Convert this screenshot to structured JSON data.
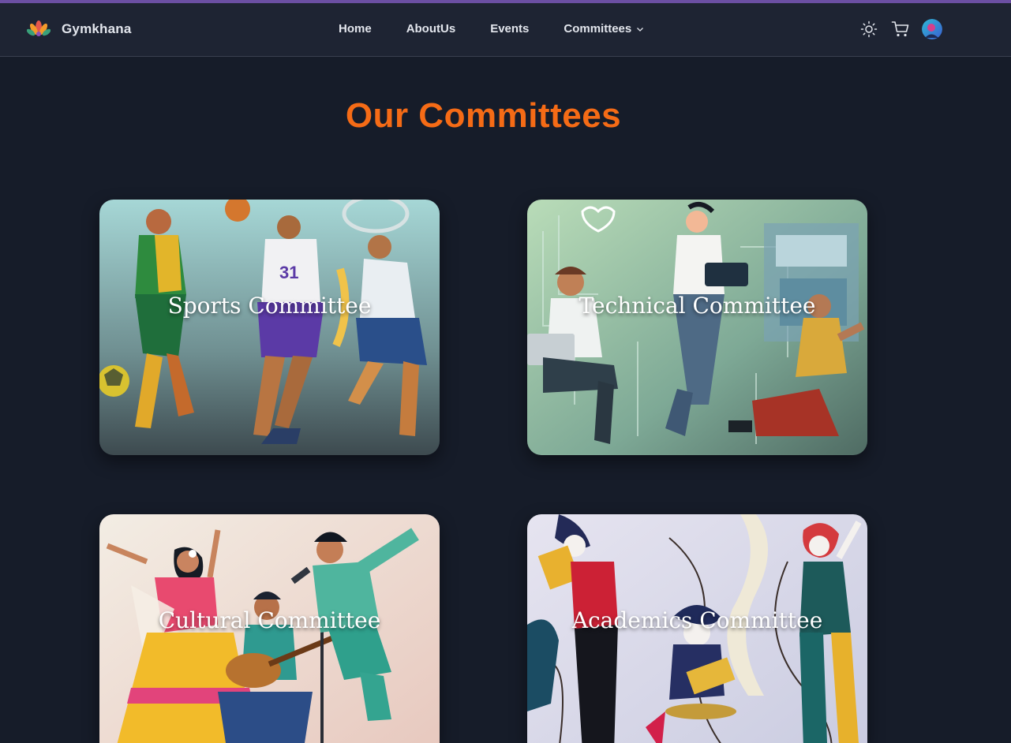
{
  "brand": {
    "name": "Gymkhana",
    "logo_icon": "lotus-logo-icon"
  },
  "nav": {
    "links": [
      "Home",
      "AboutUs",
      "Events",
      "Committees"
    ],
    "dropdown_icon": "chevron-down-icon"
  },
  "nav_icons": [
    "sun-icon",
    "cart-icon",
    "avatar"
  ],
  "page": {
    "title": "Our Committees"
  },
  "committees": [
    {
      "label": "Sports Committee"
    },
    {
      "label": "Technical Committee"
    },
    {
      "label": "Cultural Committee"
    },
    {
      "label": "Academics Committee"
    }
  ],
  "colors": {
    "background": "#161c29",
    "navbar": "#1e2433",
    "accent_bar": "#6b4fa3",
    "title": "#f56b16"
  }
}
